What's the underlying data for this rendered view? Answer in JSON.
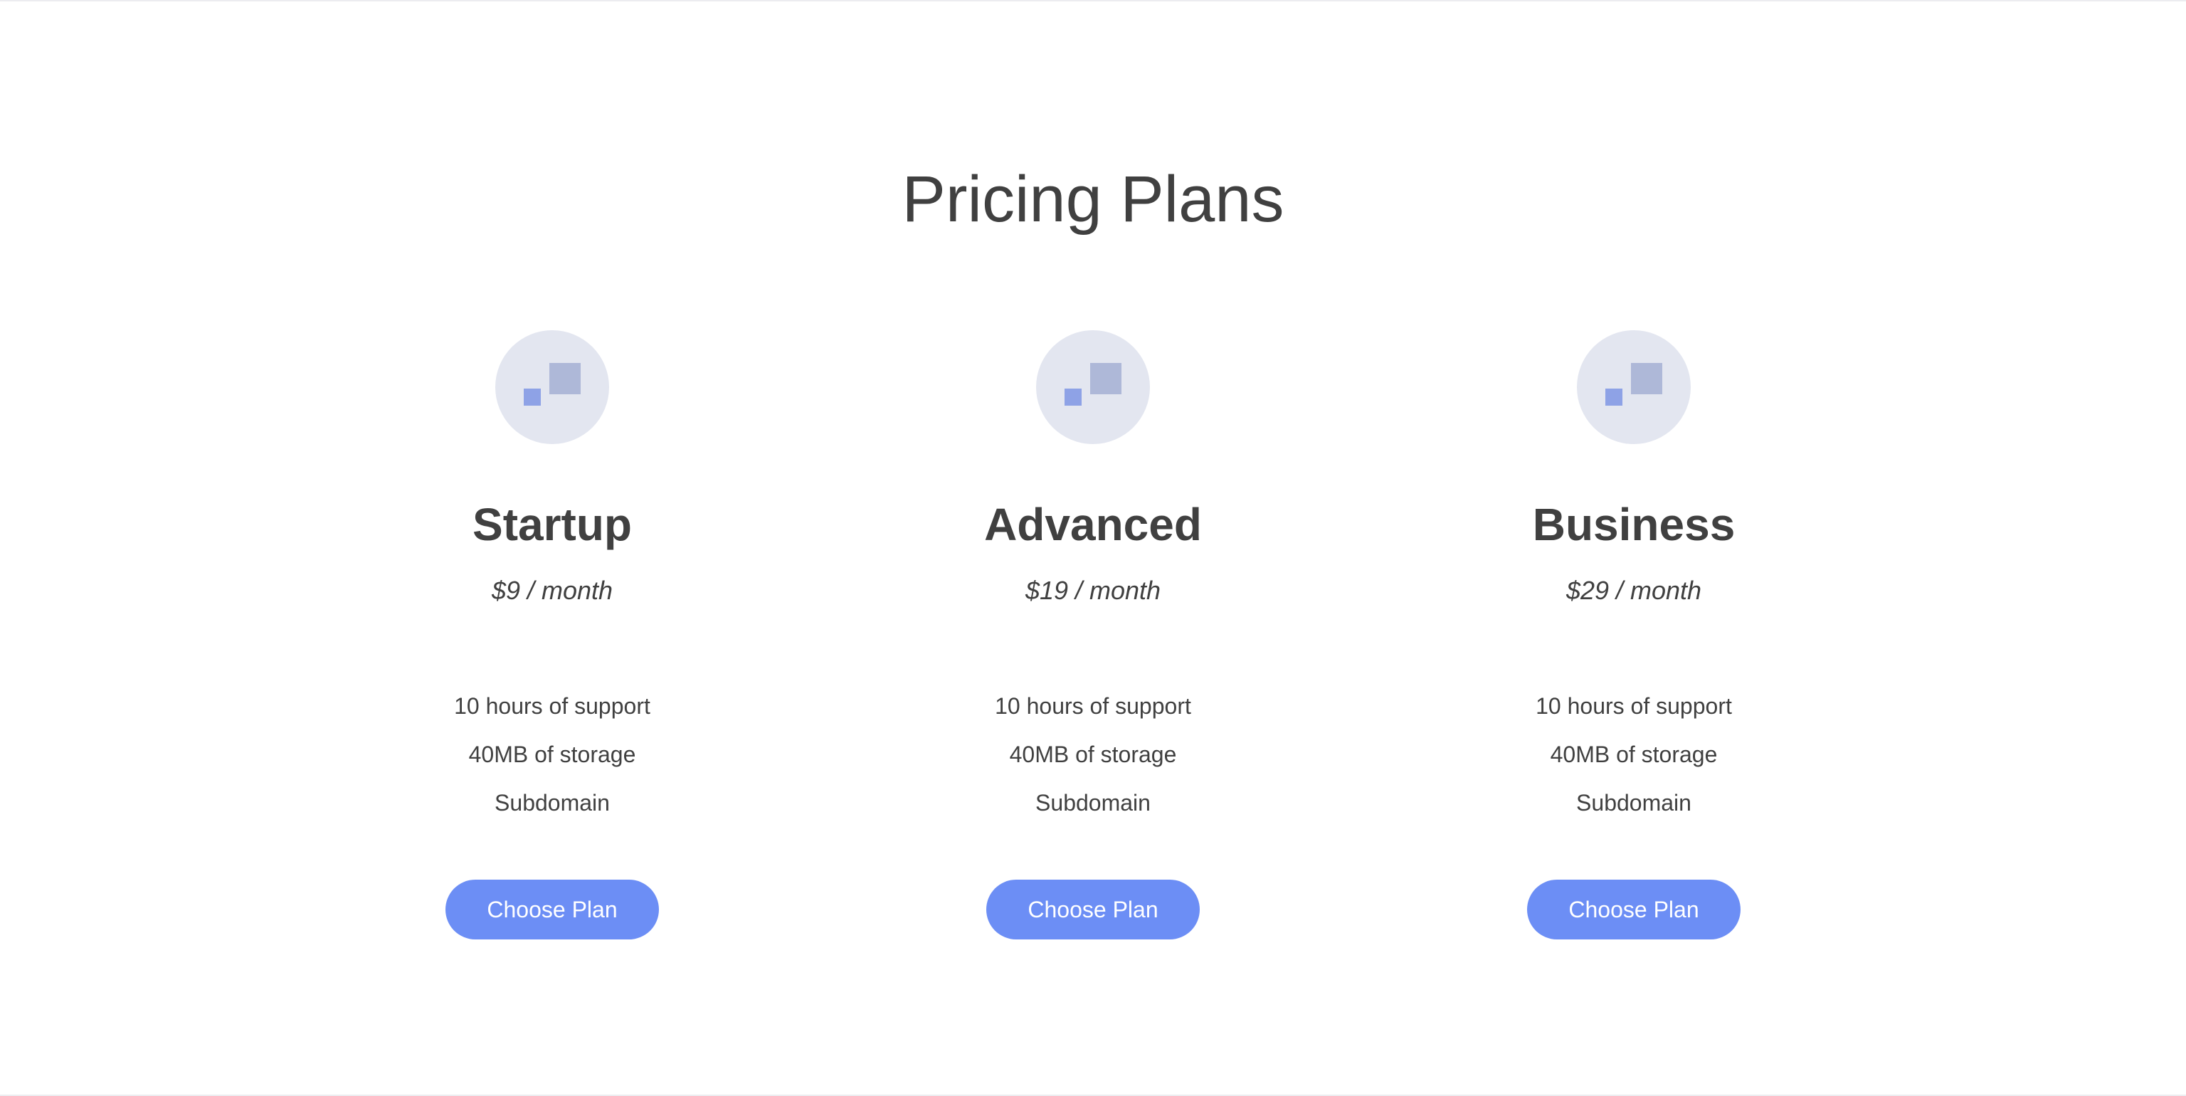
{
  "page": {
    "title": "Pricing Plans"
  },
  "colors": {
    "text": "#404040",
    "accent": "#6c8ef5",
    "icon_circle": "#e3e6f0",
    "icon_square_small": "#8ea2e6",
    "icon_square_large": "#aeb8d8"
  },
  "plans": [
    {
      "icon": "plan-squares-icon",
      "name": "Startup",
      "price": "$9 / month",
      "features": [
        "10 hours of support",
        "40MB of storage",
        "Subdomain"
      ],
      "button_label": "Choose Plan"
    },
    {
      "icon": "plan-squares-icon",
      "name": "Advanced",
      "price": "$19 / month",
      "features": [
        "10 hours of support",
        "40MB of storage",
        "Subdomain"
      ],
      "button_label": "Choose Plan"
    },
    {
      "icon": "plan-squares-icon",
      "name": "Business",
      "price": "$29 / month",
      "features": [
        "10 hours of support",
        "40MB of storage",
        "Subdomain"
      ],
      "button_label": "Choose Plan"
    }
  ]
}
